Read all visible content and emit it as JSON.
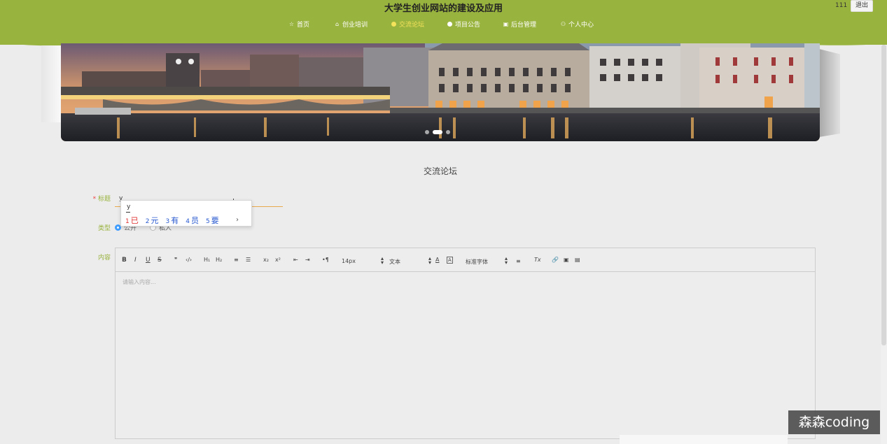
{
  "header": {
    "site_title": "大学生创业网站的建设及应用",
    "user_name": "111",
    "logout_label": "退出"
  },
  "nav": {
    "items": [
      {
        "label": "首页",
        "icon": "star-icon"
      },
      {
        "label": "创业培训",
        "icon": "bag-icon"
      },
      {
        "label": "交流论坛",
        "icon": "dot-icon",
        "active": true
      },
      {
        "label": "项目公告",
        "icon": "dot-icon"
      },
      {
        "label": "后台管理",
        "icon": "briefcase-icon"
      },
      {
        "label": "个人中心",
        "icon": "user-icon"
      }
    ],
    "active_color": "#f3e25a"
  },
  "colors": {
    "header_bg": "#99b33f",
    "accent": "#99b33f",
    "radio_accent": "#409eff"
  },
  "carousel": {
    "slide_count": 3,
    "active_index": 1
  },
  "page": {
    "section_title": "交流论坛"
  },
  "form": {
    "title_label": "标题",
    "title_value": "y",
    "type_label": "类型",
    "type_options": [
      "公开",
      "私人"
    ],
    "content_label": "内容"
  },
  "ime": {
    "composition": "y",
    "candidates": [
      {
        "num": "1",
        "text": "已"
      },
      {
        "num": "2",
        "text": "元"
      },
      {
        "num": "3",
        "text": "有"
      },
      {
        "num": "4",
        "text": "员"
      },
      {
        "num": "5",
        "text": "要"
      }
    ],
    "next": "›"
  },
  "editor": {
    "toolbar": {
      "bold": "B",
      "italic": "I",
      "underline": "U",
      "strike": "S",
      "quote": "❞",
      "code": "‹/›",
      "h1": "H₁",
      "h2": "H₂",
      "ol": "≡",
      "ul": "☰",
      "sub": "x₂",
      "sup": "x²",
      "outdent": "⇤",
      "indent": "⇥",
      "direction": "•¶",
      "size": "14px",
      "header_select": "文本",
      "color": "A",
      "background": "A",
      "font": "标准字体",
      "align": "≡",
      "clean": "Tx",
      "link": "🔗",
      "image": "▣",
      "video": "▤"
    },
    "placeholder": "请输入内容..."
  },
  "watermark": "森森coding"
}
